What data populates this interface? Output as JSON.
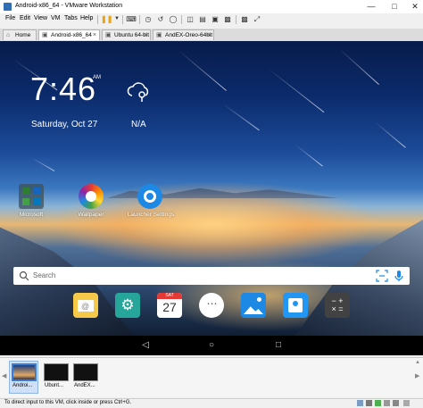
{
  "window": {
    "title": "Android-x86_64 - VMware Workstation",
    "minimize_icon": "minimize-icon",
    "maximize_icon": "maximize-icon",
    "close_icon": "close-icon"
  },
  "menu": {
    "items": [
      "File",
      "Edit",
      "View",
      "VM",
      "Tabs",
      "Help"
    ]
  },
  "tabs": [
    {
      "label": "Home",
      "active": false
    },
    {
      "label": "Android-x86_64",
      "active": true
    },
    {
      "label": "Ubuntu 64-bit",
      "active": false
    },
    {
      "label": "AndEX-Oreo-64bit",
      "active": false
    }
  ],
  "android": {
    "time": "7:46",
    "ampm": "AM",
    "date": "Saturday, Oct 27",
    "weather": "N/A",
    "apps": [
      {
        "label": "Microsoft"
      },
      {
        "label": "Wallpaper"
      },
      {
        "label": "Launcher Settings"
      }
    ],
    "search_placeholder": "Search",
    "calendar_month": "SAT",
    "calendar_day": "27"
  },
  "thumbnails": [
    {
      "label": "Androi...",
      "active": true
    },
    {
      "label": "Ubunt...",
      "active": false
    },
    {
      "label": "AndEX...",
      "active": false
    }
  ],
  "status": {
    "text": "To direct input to this VM, click inside or press Ctrl+G."
  },
  "colors": {
    "accent": "#3a7bd5",
    "pause_icon": "#e8a317"
  }
}
